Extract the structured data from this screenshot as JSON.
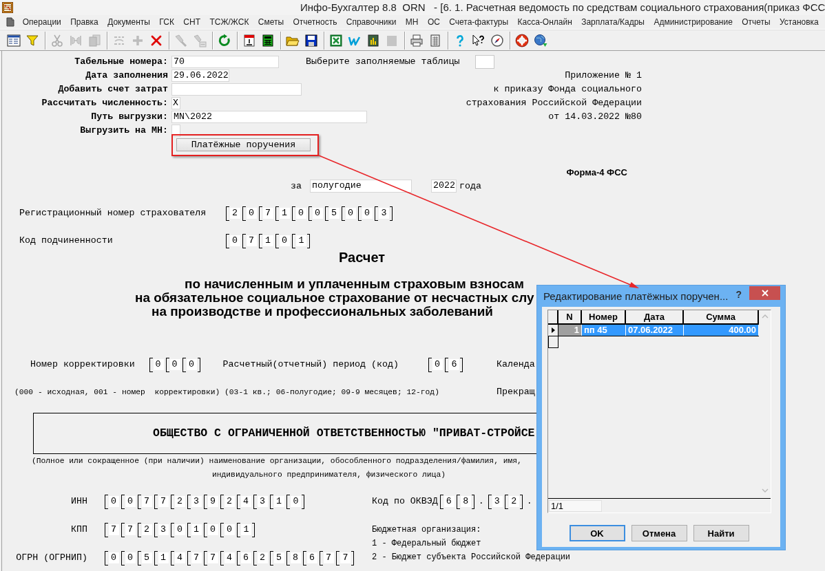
{
  "window": {
    "title": "Инфо-Бухгалтер 8.8  ORN   - [6. 1. Расчетная ведомость по средствам социального страхования(приказ ФСС"
  },
  "menu": [
    "Операции",
    "Правка",
    "Документы",
    "ГСК",
    "СНТ",
    "ТСЖ/ЖСК",
    "Сметы",
    "Отчетность",
    "Справочники",
    "МН",
    "ОС",
    "Счета-фактуры",
    "Касса-Онлайн",
    "Зарплата/Кадры",
    "Администрирование",
    "Отчеты",
    "Установка"
  ],
  "toolbar": {
    "groups": [
      [
        {
          "kind": "form",
          "disabled": false
        },
        {
          "kind": "filter",
          "disabled": false
        }
      ],
      [
        {
          "kind": "cut",
          "disabled": true
        },
        {
          "kind": "merge",
          "disabled": true
        },
        {
          "kind": "paste",
          "disabled": true
        }
      ],
      [
        {
          "kind": "rotate",
          "disabled": true
        },
        {
          "kind": "add",
          "disabled": true
        },
        {
          "kind": "delete",
          "disabled": false
        }
      ],
      [
        {
          "kind": "torch",
          "disabled": true
        },
        {
          "kind": "torchtag",
          "disabled": true
        }
      ],
      [
        {
          "kind": "refresh",
          "disabled": false
        }
      ],
      [
        {
          "kind": "calendar",
          "disabled": false
        },
        {
          "kind": "calculator",
          "disabled": false
        }
      ],
      [
        {
          "kind": "folder",
          "disabled": false
        },
        {
          "kind": "save",
          "disabled": false
        }
      ],
      [
        {
          "kind": "sheet",
          "disabled": false
        },
        {
          "kind": "zigzag",
          "disabled": false
        },
        {
          "kind": "chart",
          "disabled": false
        },
        {
          "kind": "blank",
          "disabled": true
        }
      ],
      [
        {
          "kind": "printer",
          "disabled": false
        },
        {
          "kind": "notepad",
          "disabled": false
        }
      ],
      [
        {
          "kind": "help",
          "disabled": false
        },
        {
          "kind": "pointerhelp",
          "disabled": false
        },
        {
          "kind": "compass",
          "disabled": false
        }
      ],
      [
        {
          "kind": "lifebuoy",
          "disabled": false
        },
        {
          "kind": "globe",
          "disabled": false
        }
      ]
    ]
  },
  "form": {
    "fields": [
      {
        "label": "Табельные номера:",
        "value": "70"
      },
      {
        "label": "Дата заполнения",
        "value": "29.06.2022"
      },
      {
        "label": "Добавить счет затрат"
      },
      {
        "label": "Рассчитать численность:",
        "value": "X"
      },
      {
        "label": "Путь выгрузки:",
        "value": "MN\\2022"
      },
      {
        "label": "Выгрузить на МН:"
      }
    ],
    "tables_choice": {
      "label": "Выберите заполняемые таблицы"
    },
    "appendix": [
      "Приложение № 1",
      "к приказу Фонда социального",
      "страхования Российской Федерации",
      "от 14.03.2022 №80"
    ],
    "payment_orders_button": "Платёжные поручения",
    "form_code": "Форма-4 ФСС",
    "period": {
      "prefix": "за",
      "value": "полугодие",
      "year": "2022",
      "suffix": "года"
    },
    "registration_number": {
      "label": "Регистрационный номер страхователя",
      "digits": [
        "2",
        "0",
        "7",
        "1",
        "0",
        "0",
        "5",
        "0",
        "0",
        "3"
      ]
    },
    "subordination_code": {
      "label": "Код подчиненности",
      "digits": [
        "0",
        "7",
        "1",
        "0",
        "1"
      ]
    },
    "heading": {
      "title": "Расчет",
      "lines": [
        "по начисленным и уплаченным страховым взносам",
        "на обязательное социальное страхование от несчастных слу",
        "на производстве и профессиональных заболеваний"
      ]
    },
    "correction_row": {
      "correction": {
        "label": "Номер корректировки",
        "digits": [
          "0",
          "0",
          "0"
        ]
      },
      "period_code": {
        "label": "Расчетный(отчетный) период (код)",
        "digits": [
          "0",
          "6"
        ]
      },
      "text_3": "Календа"
    },
    "note_row": {
      "note": "(000 - исходная, 001 - номер  корректировки) (03-1 кв.; 06-полугодие; 09-9 месяцев; 12-год)",
      "text_2": "Прекращ"
    },
    "organization": {
      "name": "ОБЩЕСТВО С ОГРАНИЧЕННОЙ ОТВЕТСТВЕННОСТЬЮ \"ПРИВАТ-СТРОЙСЕ",
      "caption": [
        "(Полное или сокращенное (при наличии) наименование организации, обособленного подразделения/фамилия, имя,",
        "индивидуального предпринимателя, физического лица)"
      ]
    },
    "ids": [
      {
        "label": "ИНН",
        "digits": [
          "0",
          "0",
          "7",
          "7",
          "2",
          "3",
          "9",
          "2",
          "4",
          "3",
          "1",
          "0"
        ]
      },
      {
        "label": "КПП",
        "digits": [
          "7",
          "7",
          "2",
          "3",
          "0",
          "1",
          "0",
          "0",
          "1"
        ]
      },
      {
        "label": "ОГРН (ОГРНИП)",
        "digits": [
          "0",
          "0",
          "5",
          "1",
          "4",
          "7",
          "7",
          "4",
          "6",
          "2",
          "5",
          "8",
          "6",
          "7",
          "7"
        ]
      }
    ],
    "okved": {
      "label": "Код по ОКВЭД",
      "parts": [
        {
          "kind": "digits",
          "digits": [
            "6",
            "8"
          ]
        },
        {
          "kind": "dot",
          "text": "."
        },
        {
          "kind": "digits",
          "digits": [
            "3",
            "2"
          ]
        },
        {
          "kind": "dot",
          "text": "."
        }
      ]
    },
    "budget": {
      "title": "Бюджетная организация:",
      "options": [
        "1 - Федеральный бюджет",
        "2 - Бюджет субъекта Российской Федерации"
      ]
    }
  },
  "dialog": {
    "title": "Редактирование платёжных поручен...",
    "help": "?",
    "table": {
      "columns": [
        "N",
        "Номер",
        "Дата",
        "Сумма"
      ],
      "rows": [
        {
          "cells": [
            "1",
            "пп 45",
            "07.06.2022",
            "400.00"
          ],
          "selected": true
        }
      ]
    },
    "record_counter": "1/1",
    "buttons": [
      {
        "label": "OK",
        "default": true
      },
      {
        "label": "Отмена",
        "default": false
      },
      {
        "label": "Найти",
        "default": false
      }
    ]
  }
}
